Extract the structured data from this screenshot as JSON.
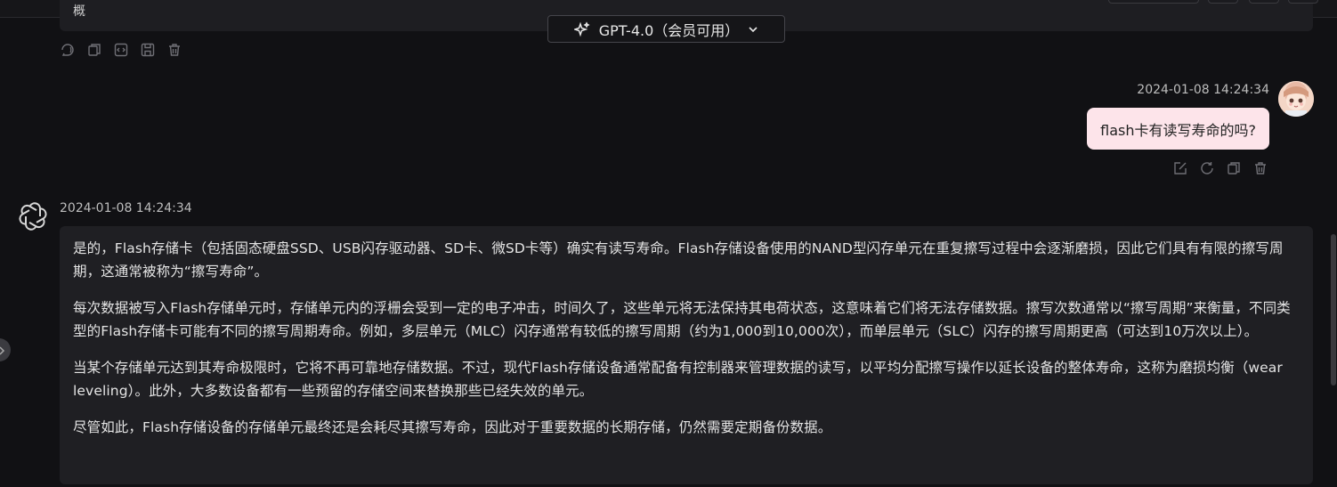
{
  "header": {
    "model_selector": {
      "label": "GPT-4.0（会员可用）",
      "icon": "sparkle-icon",
      "chevron": "chevron-down-icon"
    }
  },
  "previous_message": {
    "text": "概"
  },
  "previous_message_actions": [
    "voice-icon",
    "copy-icon",
    "code-icon",
    "save-icon",
    "delete-icon"
  ],
  "user_message": {
    "timestamp": "2024-01-08 14:24:34",
    "text": "flash卡有读写寿命的吗?",
    "actions": [
      "edit-icon",
      "regenerate-icon",
      "copy-icon",
      "delete-icon"
    ],
    "bubble_color": "#fde4ea"
  },
  "assistant_message": {
    "timestamp": "2024-01-08 14:24:34",
    "paragraphs": [
      "是的，Flash存储卡（包括固态硬盘SSD、USB闪存驱动器、SD卡、微SD卡等）确实有读写寿命。Flash存储设备使用的NAND型闪存单元在重复擦写过程中会逐渐磨损，因此它们具有有限的擦写周期，这通常被称为“擦写寿命”。",
      "每次数据被写入Flash存储单元时，存储单元内的浮栅会受到一定的电子冲击，时间久了，这些单元将无法保持其电荷状态，这意味着它们将无法存储数据。擦写次数通常以“擦写周期”来衡量，不同类型的Flash存储卡可能有不同的擦写周期寿命。例如，多层单元（MLC）闪存通常有较低的擦写周期（约为1,000到10,000次），而单层单元（SLC）闪存的擦写周期更高（可达到10万次以上）。",
      "当某个存储单元达到其寿命极限时，它将不再可靠地存储数据。不过，现代Flash存储设备通常配备有控制器来管理数据的读写，以平均分配擦写操作以延长设备的整体寿命，这称为磨损均衡（wear leveling）。此外，大多数设备都有一些预留的存储空间来替换那些已经失效的单元。",
      "尽管如此，Flash存储设备的存储单元最终还是会耗尽其擦写寿命，因此对于重要数据的长期存储，仍然需要定期备份数据。"
    ]
  },
  "colors": {
    "background": "#111114",
    "assistant_bubble": "#1f1f23",
    "user_bubble": "#fde4ea"
  }
}
